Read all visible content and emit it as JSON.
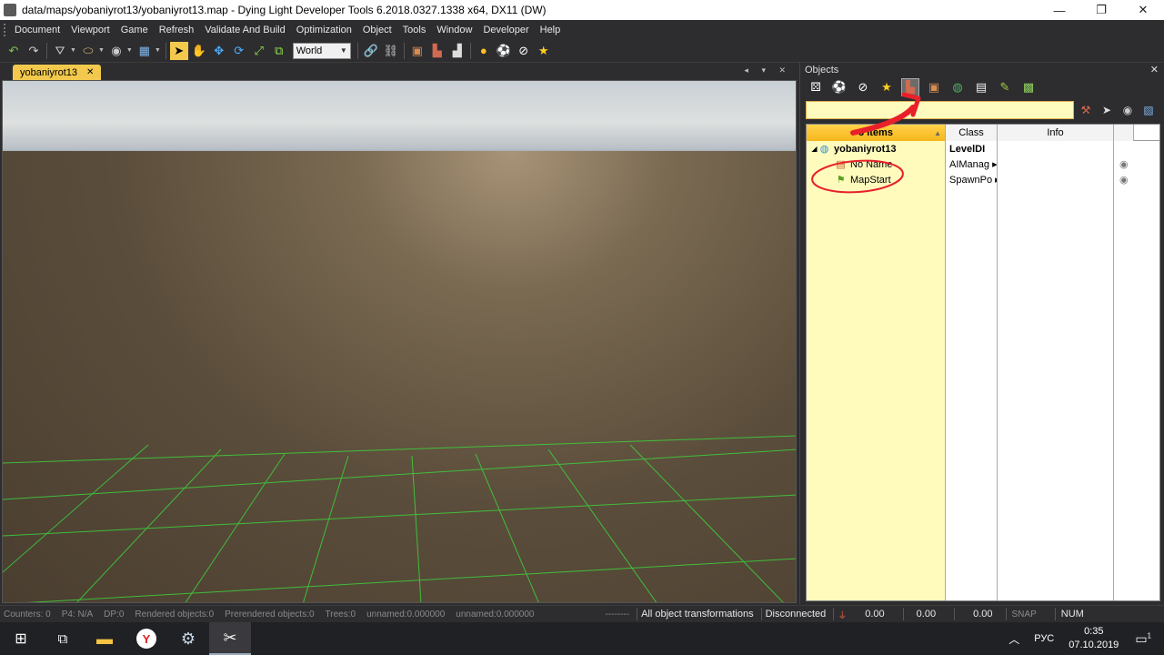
{
  "window": {
    "title": "data/maps/yobaniyrot13/yobaniyrot13.map - Dying Light Developer Tools 6.2018.0327.1338 x64, DX11 (DW)",
    "minimize": "—",
    "maximize": "❐",
    "close": "✕"
  },
  "menu": [
    "Document",
    "Viewport",
    "Game",
    "Refresh",
    "Validate And Build",
    "Optimization",
    "Object",
    "Tools",
    "Window",
    "Developer",
    "Help"
  ],
  "toolbar": {
    "coord_space": "World"
  },
  "viewport": {
    "tab_label": "yobaniyrot13",
    "tab_close": "✕",
    "tab_controls": "◂ ▾ ✕"
  },
  "objects_panel": {
    "title": "Objects",
    "close": "✕",
    "search_value": "",
    "columns": {
      "name": "3 items",
      "class": "Class",
      "info": "Info"
    },
    "rows": [
      {
        "name": "yobaniyrot13",
        "class": "LevelDI",
        "bold": true
      },
      {
        "name": "No Name",
        "class": "AIManag ▸"
      },
      {
        "name": "MapStart",
        "class": "SpawnPo ▸"
      }
    ]
  },
  "statusbar": {
    "counters": "Counters: 0",
    "p4": "P4: N/A",
    "dp": "DP:0",
    "rendered": "Rendered objects:0",
    "prerendered": "Prerendered objects:0",
    "trees": "Trees:0",
    "unnamed1": "unnamed:0.000000",
    "unnamed2": "unnamed:0.000000",
    "dashes": "--------",
    "mode": "All object transformations",
    "connection": "Disconnected",
    "x": "0.00",
    "y": "0.00",
    "z": "0.00",
    "snap": "SNAP",
    "num": "NUM"
  },
  "taskbar": {
    "lang": "РУС",
    "time": "0:35",
    "date": "07.10.2019",
    "notif_count": "1"
  },
  "colors": {
    "accent_tab": "#f2c94c",
    "grid": "#3cd23c",
    "annotation": "#e8202a"
  }
}
